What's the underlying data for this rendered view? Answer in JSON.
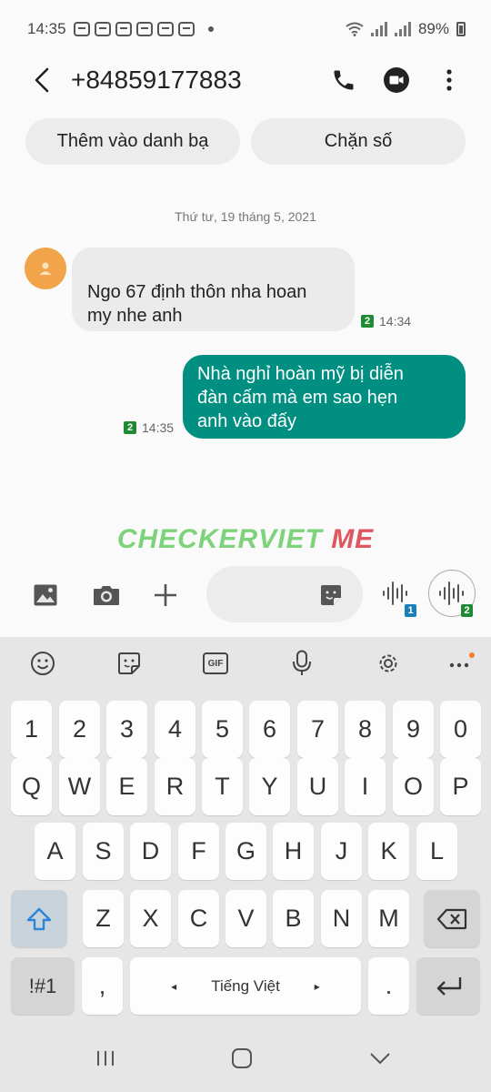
{
  "status": {
    "time": "14:35",
    "battery": "89%"
  },
  "header": {
    "title": "+84859177883"
  },
  "pills": {
    "add_contact": "Thêm vào danh bạ",
    "block": "Chặn số"
  },
  "conversation": {
    "date": "Thứ tư, 19 tháng 5, 2021",
    "incoming": {
      "line1": "Ngo 67 định thôn nha hoan",
      "line2": "my nhe anh",
      "sim": "2",
      "time": "14:34"
    },
    "outgoing": {
      "line1": "Nhà nghỉ hoàn mỹ bị diễn",
      "line2": "đàn cấm mà em sao hẹn",
      "line3": "anh vào đấy",
      "sim": "2",
      "time": "14:35"
    }
  },
  "watermark": {
    "part1": "CHECKERVIET",
    "part2": "ME"
  },
  "compose": {
    "voice_sim1": "1",
    "voice_sim2": "2"
  },
  "keyboard": {
    "tools": [
      "emoji-icon",
      "sticker-icon",
      "gif-icon",
      "mic-icon",
      "settings-icon",
      "more-icon"
    ],
    "gif_label": "GIF",
    "row_numbers": [
      "1",
      "2",
      "3",
      "4",
      "5",
      "6",
      "7",
      "8",
      "9",
      "0"
    ],
    "row1": [
      "Q",
      "W",
      "E",
      "R",
      "T",
      "Y",
      "U",
      "I",
      "O",
      "P"
    ],
    "row2": [
      "A",
      "S",
      "D",
      "F",
      "G",
      "H",
      "J",
      "K",
      "L"
    ],
    "row3": [
      "Z",
      "X",
      "C",
      "V",
      "B",
      "N",
      "M"
    ],
    "symbols": "!#1",
    "comma": ",",
    "space": "Tiếng Việt",
    "left_arrow": "◂",
    "right_arrow": "▸",
    "period": "."
  },
  "colors": {
    "outgoing_bubble": "#008f80",
    "avatar": "#f2a44a",
    "sim_badge": "#1e8a33",
    "voice_badge1": "#1a7fb8"
  }
}
